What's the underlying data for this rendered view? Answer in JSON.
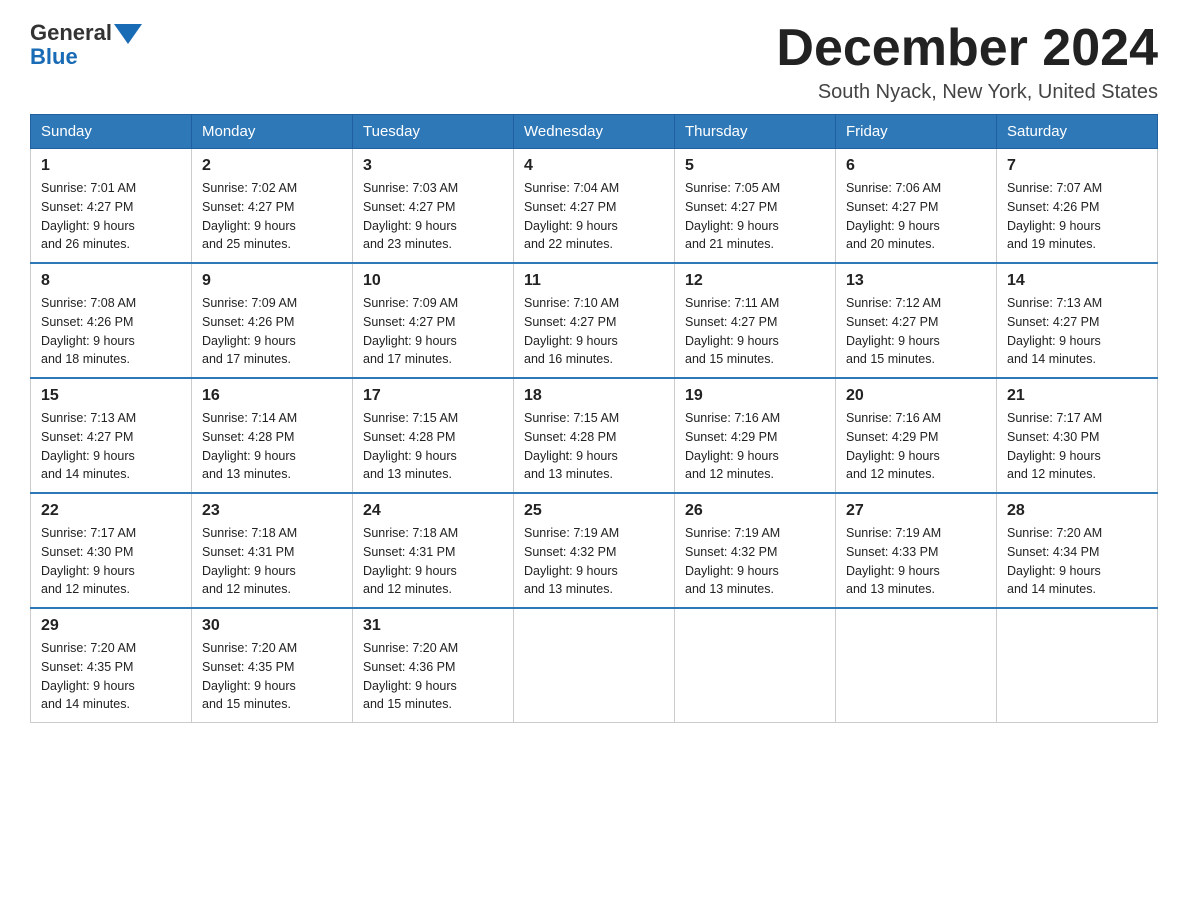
{
  "header": {
    "logo_general": "General",
    "logo_blue": "Blue",
    "title": "December 2024",
    "subtitle": "South Nyack, New York, United States"
  },
  "days_of_week": [
    "Sunday",
    "Monday",
    "Tuesday",
    "Wednesday",
    "Thursday",
    "Friday",
    "Saturday"
  ],
  "weeks": [
    [
      {
        "day": "1",
        "sunrise": "7:01 AM",
        "sunset": "4:27 PM",
        "daylight": "9 hours and 26 minutes."
      },
      {
        "day": "2",
        "sunrise": "7:02 AM",
        "sunset": "4:27 PM",
        "daylight": "9 hours and 25 minutes."
      },
      {
        "day": "3",
        "sunrise": "7:03 AM",
        "sunset": "4:27 PM",
        "daylight": "9 hours and 23 minutes."
      },
      {
        "day": "4",
        "sunrise": "7:04 AM",
        "sunset": "4:27 PM",
        "daylight": "9 hours and 22 minutes."
      },
      {
        "day": "5",
        "sunrise": "7:05 AM",
        "sunset": "4:27 PM",
        "daylight": "9 hours and 21 minutes."
      },
      {
        "day": "6",
        "sunrise": "7:06 AM",
        "sunset": "4:27 PM",
        "daylight": "9 hours and 20 minutes."
      },
      {
        "day": "7",
        "sunrise": "7:07 AM",
        "sunset": "4:26 PM",
        "daylight": "9 hours and 19 minutes."
      }
    ],
    [
      {
        "day": "8",
        "sunrise": "7:08 AM",
        "sunset": "4:26 PM",
        "daylight": "9 hours and 18 minutes."
      },
      {
        "day": "9",
        "sunrise": "7:09 AM",
        "sunset": "4:26 PM",
        "daylight": "9 hours and 17 minutes."
      },
      {
        "day": "10",
        "sunrise": "7:09 AM",
        "sunset": "4:27 PM",
        "daylight": "9 hours and 17 minutes."
      },
      {
        "day": "11",
        "sunrise": "7:10 AM",
        "sunset": "4:27 PM",
        "daylight": "9 hours and 16 minutes."
      },
      {
        "day": "12",
        "sunrise": "7:11 AM",
        "sunset": "4:27 PM",
        "daylight": "9 hours and 15 minutes."
      },
      {
        "day": "13",
        "sunrise": "7:12 AM",
        "sunset": "4:27 PM",
        "daylight": "9 hours and 15 minutes."
      },
      {
        "day": "14",
        "sunrise": "7:13 AM",
        "sunset": "4:27 PM",
        "daylight": "9 hours and 14 minutes."
      }
    ],
    [
      {
        "day": "15",
        "sunrise": "7:13 AM",
        "sunset": "4:27 PM",
        "daylight": "9 hours and 14 minutes."
      },
      {
        "day": "16",
        "sunrise": "7:14 AM",
        "sunset": "4:28 PM",
        "daylight": "9 hours and 13 minutes."
      },
      {
        "day": "17",
        "sunrise": "7:15 AM",
        "sunset": "4:28 PM",
        "daylight": "9 hours and 13 minutes."
      },
      {
        "day": "18",
        "sunrise": "7:15 AM",
        "sunset": "4:28 PM",
        "daylight": "9 hours and 13 minutes."
      },
      {
        "day": "19",
        "sunrise": "7:16 AM",
        "sunset": "4:29 PM",
        "daylight": "9 hours and 12 minutes."
      },
      {
        "day": "20",
        "sunrise": "7:16 AM",
        "sunset": "4:29 PM",
        "daylight": "9 hours and 12 minutes."
      },
      {
        "day": "21",
        "sunrise": "7:17 AM",
        "sunset": "4:30 PM",
        "daylight": "9 hours and 12 minutes."
      }
    ],
    [
      {
        "day": "22",
        "sunrise": "7:17 AM",
        "sunset": "4:30 PM",
        "daylight": "9 hours and 12 minutes."
      },
      {
        "day": "23",
        "sunrise": "7:18 AM",
        "sunset": "4:31 PM",
        "daylight": "9 hours and 12 minutes."
      },
      {
        "day": "24",
        "sunrise": "7:18 AM",
        "sunset": "4:31 PM",
        "daylight": "9 hours and 12 minutes."
      },
      {
        "day": "25",
        "sunrise": "7:19 AM",
        "sunset": "4:32 PM",
        "daylight": "9 hours and 13 minutes."
      },
      {
        "day": "26",
        "sunrise": "7:19 AM",
        "sunset": "4:32 PM",
        "daylight": "9 hours and 13 minutes."
      },
      {
        "day": "27",
        "sunrise": "7:19 AM",
        "sunset": "4:33 PM",
        "daylight": "9 hours and 13 minutes."
      },
      {
        "day": "28",
        "sunrise": "7:20 AM",
        "sunset": "4:34 PM",
        "daylight": "9 hours and 14 minutes."
      }
    ],
    [
      {
        "day": "29",
        "sunrise": "7:20 AM",
        "sunset": "4:35 PM",
        "daylight": "9 hours and 14 minutes."
      },
      {
        "day": "30",
        "sunrise": "7:20 AM",
        "sunset": "4:35 PM",
        "daylight": "9 hours and 15 minutes."
      },
      {
        "day": "31",
        "sunrise": "7:20 AM",
        "sunset": "4:36 PM",
        "daylight": "9 hours and 15 minutes."
      },
      null,
      null,
      null,
      null
    ]
  ],
  "labels": {
    "sunrise": "Sunrise:",
    "sunset": "Sunset:",
    "daylight": "Daylight:"
  }
}
